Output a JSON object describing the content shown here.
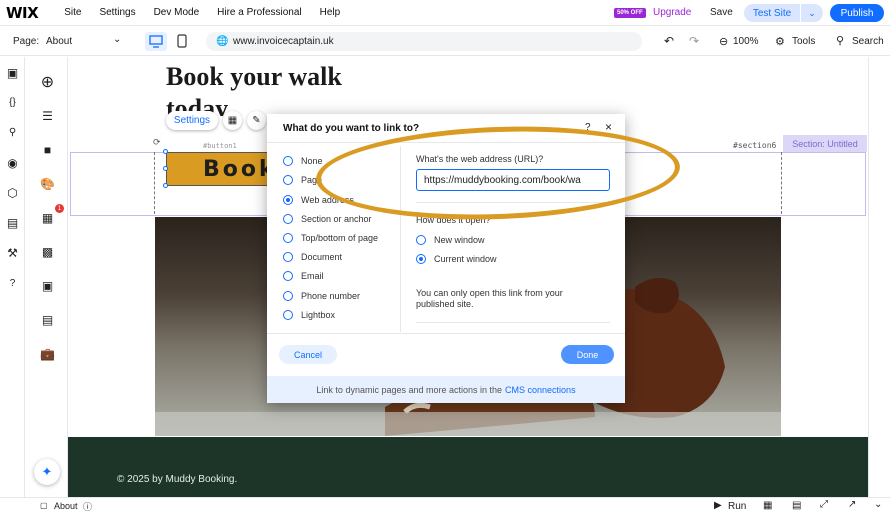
{
  "topbar": {
    "logo": "WIX",
    "menu": [
      "Site",
      "Settings",
      "Dev Mode",
      "Hire a Professional",
      "Help"
    ],
    "upsell_badge": "50% OFF",
    "upgrade": "Upgrade",
    "save": "Save",
    "test_site": "Test Site",
    "publish": "Publish"
  },
  "secondbar": {
    "page_label": "Page:",
    "page_value": "About",
    "url": "www.invoicecaptain.uk",
    "zoom": "100%",
    "tools": "Tools",
    "search": "Search"
  },
  "canvas": {
    "heading": "Book your walk",
    "heading2": "today",
    "settings_button": "Settings",
    "button_label_hint": "#button1",
    "section_id": "#section6",
    "section_badge": "Section: Untitled",
    "book_button": "Book",
    "footer_text": "© 2025 by Muddy Booking."
  },
  "dialog": {
    "title": "What do you want to link to?",
    "help": "?",
    "close": "×",
    "options": [
      "None",
      "Page",
      "Web address",
      "Section or anchor",
      "Top/bottom of page",
      "Document",
      "Email",
      "Phone number",
      "Lightbox"
    ],
    "selected_option": "Web address",
    "url_label": "What's the web address (URL)?",
    "url_value": "https://muddybooking.com/book/wa",
    "open_label": "How does it open?",
    "open_options": [
      "New window",
      "Current window"
    ],
    "open_selected": "Current window",
    "note": "You can only open this link from your published site.",
    "cancel": "Cancel",
    "done": "Done",
    "footer_text": "Link to dynamic pages and more actions in the",
    "footer_link": "CMS connections"
  },
  "bottombar": {
    "page": "About",
    "run": "Run"
  },
  "colors": {
    "accent": "#116dff",
    "highlight": "#d99b22",
    "footer_bg": "#1d3528",
    "upsell": "#9a27d5"
  }
}
